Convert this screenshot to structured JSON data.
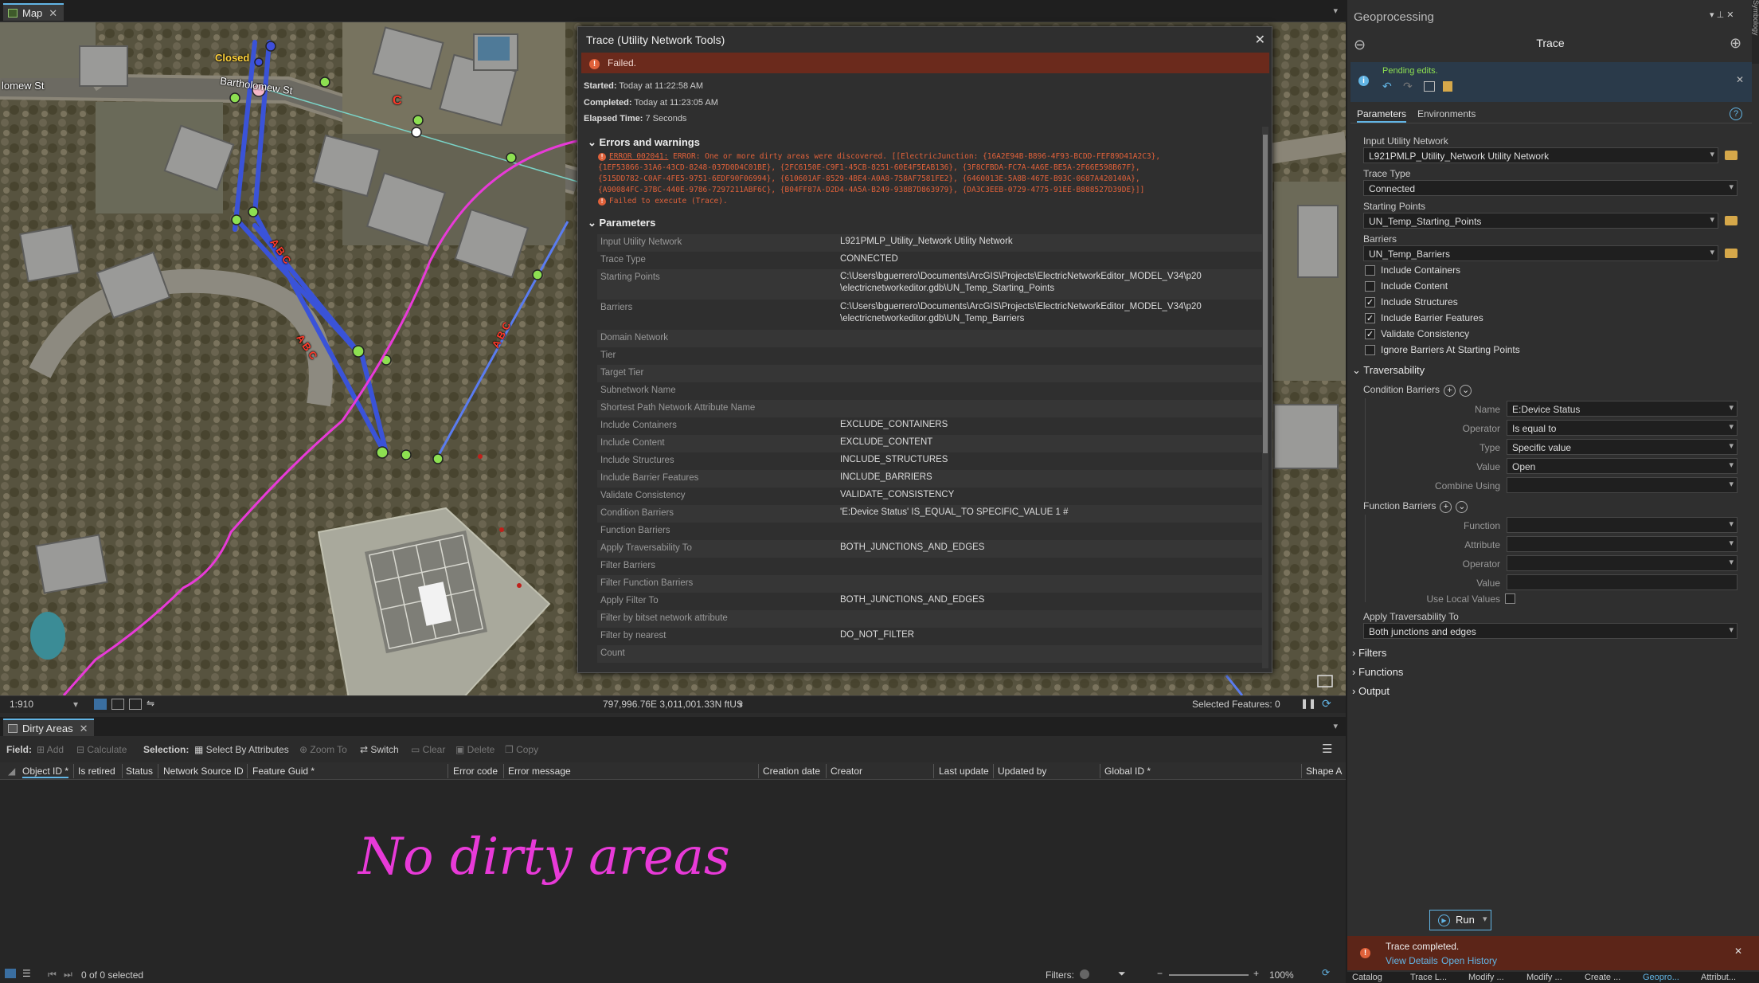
{
  "map_tab": {
    "label": "Map"
  },
  "map": {
    "labels": {
      "closed": "Closed",
      "street_left": "lomew St",
      "street_main": "Bartholomew St",
      "abc1": "A B C",
      "abc2": "A B C",
      "abc3": "A B C",
      "c_label": "C"
    }
  },
  "dialog": {
    "title": "Trace (Utility Network Tools)",
    "status": "Failed.",
    "started_label": "Started:",
    "started": "Today at 11:22:58 AM",
    "completed_label": "Completed:",
    "completed": "Today at 11:23:05 AM",
    "elapsed_label": "Elapsed Time:",
    "elapsed": "7 Seconds",
    "errors_heading": "Errors and warnings",
    "error_code": "ERROR 002041:",
    "error_lines": [
      "ERROR: One or more dirty areas were discovered. [[ElectricJunction: {16A2E94B-B896-4F93-BCDD-FEF89D41A2C3},",
      "{1EF53866-31A6-43CD-8248-037D0D4C01BE}, {2FC6150E-C9F1-45CB-8251-60E4F5EAB136}, {3F8CFBDA-FC7A-4A6E-BE5A-2F66E598B67F},",
      "{515DD782-C0AF-4FE5-9751-6EDF90F06994}, {610601AF-8529-4BE4-A0A8-758AF7581FE2}, {6460013E-5A8B-467E-B93C-0687A420140A},",
      "{A90084FC-37BC-440E-9786-7297211ABF6C}, {B04FF87A-D2D4-4A5A-B249-938B7D863979}, {DA3C3EEB-0729-4775-91EE-B888527D39DE}]]"
    ],
    "error_failed": "Failed to execute (Trace).",
    "params_heading": "Parameters",
    "params": [
      {
        "name": "Input Utility Network",
        "value": "L921PMLP_Utility_Network Utility Network"
      },
      {
        "name": "Trace Type",
        "value": "CONNECTED"
      },
      {
        "name": "Starting Points",
        "value": "C:\\Users\\bguerrero\\Documents\\ArcGIS\\Projects\\ElectricNetworkEditor_MODEL_V34\\p20",
        "value2": "\\electricnetworkeditor.gdb\\UN_Temp_Starting_Points"
      },
      {
        "name": "Barriers",
        "value": "C:\\Users\\bguerrero\\Documents\\ArcGIS\\Projects\\ElectricNetworkEditor_MODEL_V34\\p20",
        "value2": "\\electricnetworkeditor.gdb\\UN_Temp_Barriers"
      },
      {
        "name": "Domain Network",
        "value": ""
      },
      {
        "name": "Tier",
        "value": ""
      },
      {
        "name": "Target Tier",
        "value": ""
      },
      {
        "name": "Subnetwork Name",
        "value": ""
      },
      {
        "name": "Shortest Path Network Attribute Name",
        "value": ""
      },
      {
        "name": "Include Containers",
        "value": "EXCLUDE_CONTAINERS"
      },
      {
        "name": "Include Content",
        "value": "EXCLUDE_CONTENT"
      },
      {
        "name": "Include Structures",
        "value": "INCLUDE_STRUCTURES"
      },
      {
        "name": "Include Barrier Features",
        "value": "INCLUDE_BARRIERS"
      },
      {
        "name": "Validate Consistency",
        "value": "VALIDATE_CONSISTENCY"
      },
      {
        "name": "Condition Barriers",
        "value": "'E:Device Status' IS_EQUAL_TO SPECIFIC_VALUE 1 #"
      },
      {
        "name": "Function Barriers",
        "value": ""
      },
      {
        "name": "Apply Traversability To",
        "value": "BOTH_JUNCTIONS_AND_EDGES"
      },
      {
        "name": "Filter Barriers",
        "value": ""
      },
      {
        "name": "Filter Function Barriers",
        "value": ""
      },
      {
        "name": "Apply Filter To",
        "value": "BOTH_JUNCTIONS_AND_EDGES"
      },
      {
        "name": "Filter by bitset network attribute",
        "value": ""
      },
      {
        "name": "Filter by nearest",
        "value": "DO_NOT_FILTER"
      },
      {
        "name": "Count",
        "value": ""
      }
    ]
  },
  "map_status": {
    "scale": "1:910",
    "coords": "797,996.76E 3,011,001.33N ftUS",
    "selected": "Selected Features: 0"
  },
  "attr_table": {
    "tab_label": "Dirty Areas",
    "field_label": "Field:",
    "add": "Add",
    "calculate": "Calculate",
    "selection_label": "Selection:",
    "select_by_attr": "Select By Attributes",
    "zoom_to": "Zoom To",
    "switch": "Switch",
    "clear": "Clear",
    "delete": "Delete",
    "copy": "Copy",
    "columns": [
      "Object ID *",
      "Is retired",
      "Status",
      "Network Source ID",
      "Feature Guid *",
      "Error code",
      "Error message",
      "Creation date",
      "Creator",
      "Last update",
      "Updated by",
      "Global ID *",
      "Shape A"
    ],
    "annotation": "No dirty areas",
    "status": "0 of 0 selected",
    "filters_label": "Filters:",
    "zoom": "100%"
  },
  "gp": {
    "pane_title": "Geoprocessing",
    "tool_title": "Trace",
    "pending": "Pending edits.",
    "tab_params": "Parameters",
    "tab_env": "Environments",
    "input_un_label": "Input Utility Network",
    "input_un_value": "L921PMLP_Utility_Network Utility Network",
    "trace_type_label": "Trace Type",
    "trace_type_value": "Connected",
    "starting_label": "Starting Points",
    "starting_value": "UN_Temp_Starting_Points",
    "barriers_label": "Barriers",
    "barriers_value": "UN_Temp_Barriers",
    "checkboxes": [
      {
        "label": "Include Containers",
        "checked": false
      },
      {
        "label": "Include Content",
        "checked": false
      },
      {
        "label": "Include Structures",
        "checked": true
      },
      {
        "label": "Include Barrier Features",
        "checked": true
      },
      {
        "label": "Validate Consistency",
        "checked": true
      },
      {
        "label": "Ignore Barriers At Starting Points",
        "checked": false
      }
    ],
    "traversability": "Traversability",
    "condition_barriers": "Condition Barriers",
    "cb_name_label": "Name",
    "cb_name_value": "E:Device Status",
    "cb_operator_label": "Operator",
    "cb_operator_value": "Is equal to",
    "cb_type_label": "Type",
    "cb_type_value": "Specific value",
    "cb_value_label": "Value",
    "cb_value_value": "Open",
    "cb_combine_label": "Combine Using",
    "function_barriers": "Function Barriers",
    "fb_function_label": "Function",
    "fb_attribute_label": "Attribute",
    "fb_operator_label": "Operator",
    "fb_value_label": "Value",
    "use_local_values": "Use Local Values",
    "apply_trav_label": "Apply Traversability To",
    "apply_trav_value": "Both junctions and edges",
    "filters": "Filters",
    "functions": "Functions",
    "output": "Output",
    "run": "Run",
    "toast_title": "Trace completed.",
    "view_details": "View Details",
    "open_history": "Open History",
    "bottom_tabs": [
      "Catalog",
      "Trace L...",
      "Modify ...",
      "Modify ...",
      "Create ...",
      "Geopro...",
      "Attribut..."
    ],
    "side_label": "Symbology"
  }
}
